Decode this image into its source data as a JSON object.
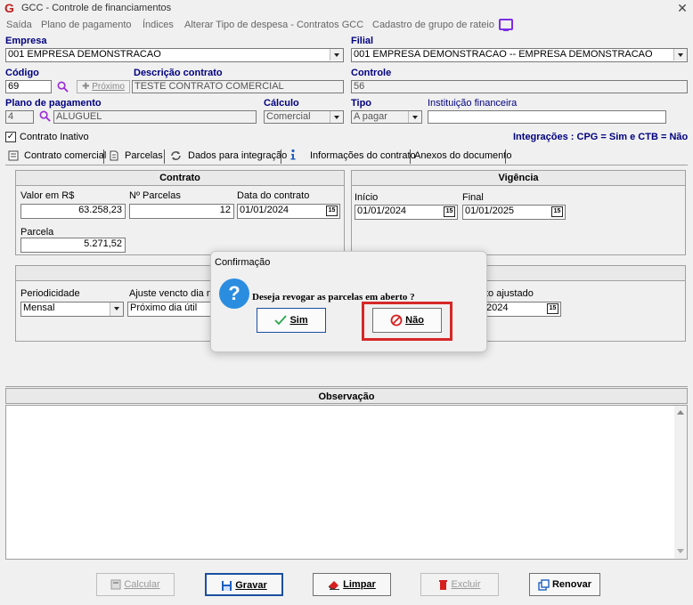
{
  "window": {
    "title": "GCC - Controle de financiamentos",
    "close": "✕"
  },
  "menu": [
    {
      "label": "Saída"
    },
    {
      "label": "Plano de pagamento"
    },
    {
      "label": "Índices"
    },
    {
      "label": "Alterar Tipo de despesa - Contratos GCC"
    },
    {
      "label": "Cadastro de grupo de rateio"
    }
  ],
  "empresa": {
    "label": "Empresa",
    "value": "001 EMPRESA DEMONSTRACAO"
  },
  "filial": {
    "label": "Filial",
    "value": "001 EMPRESA DEMONSTRACAO -- EMPRESA DEMONSTRACAO"
  },
  "codigo": {
    "label": "Código",
    "value": "69",
    "proximo": "Próximo"
  },
  "descricao": {
    "label": "Descrição contrato",
    "value": "TESTE CONTRATO COMERCIAL"
  },
  "controle": {
    "label": "Controle",
    "value": "56"
  },
  "plano": {
    "label": "Plano de pagamento",
    "code": "4",
    "value": "ALUGUEL"
  },
  "calculo": {
    "label": "Cálculo",
    "value": "Comercial"
  },
  "tipo": {
    "label": "Tipo",
    "value": "A pagar"
  },
  "instituicao": {
    "label": "Instituição financeira",
    "value": ""
  },
  "inativo": {
    "label": "Contrato Inativo",
    "checked": "✓"
  },
  "integracoes": "Integrações : CPG = Sim e CTB = Não",
  "tabs": [
    {
      "label": "Contrato comercial"
    },
    {
      "label": "Parcelas"
    },
    {
      "label": "Dados para integração"
    },
    {
      "label": "Informações do contrato"
    },
    {
      "label": "Anexos do documento"
    }
  ],
  "contrato": {
    "title": "Contrato",
    "valor_label": "Valor em R$",
    "valor": "63.258,23",
    "nparcelas_label": "Nº Parcelas",
    "nparcelas": "12",
    "data_label": "Data do contrato",
    "data": "01/01/2024",
    "parcela_label": "Parcela",
    "parcela": "5.271,52"
  },
  "vigencia": {
    "title": "Vigência",
    "inicio_label": "Início",
    "inicio": "01/01/2024",
    "final_label": "Final",
    "final": "01/01/2025"
  },
  "ajustes": {
    "periodicidade_label": "Periodicidade",
    "periodicidade": "Mensal",
    "ajuste_label": "Ajuste vencto dia não",
    "ajuste": "Próximo dia útil",
    "vencto_label": "to ajustado",
    "vencto": "2024"
  },
  "calendar_glyph": "15",
  "observacao": {
    "title": "Observação"
  },
  "dialog": {
    "title": "Confirmação",
    "icon": "?",
    "message": "Deseja revogar as parcelas em aberto ?",
    "sim": "Sim",
    "nao": "Não"
  },
  "footer": {
    "calcular": "Calcular",
    "gravar": "Gravar",
    "limpar": "Limpar",
    "excluir": "Excluir",
    "renovar": "Renovar"
  }
}
